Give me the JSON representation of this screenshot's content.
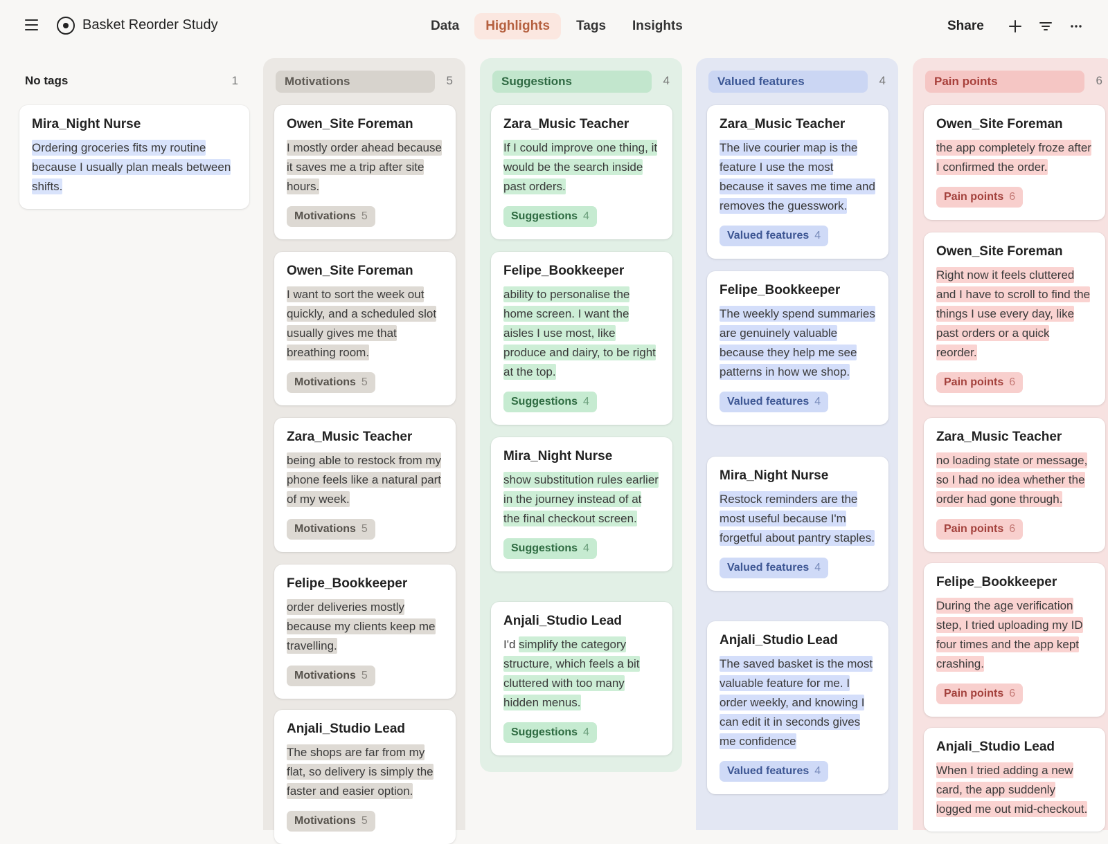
{
  "app": {
    "title": "Basket Reorder Study"
  },
  "tabs": [
    {
      "label": "Data"
    },
    {
      "label": "Highlights",
      "active": true
    },
    {
      "label": "Tags"
    },
    {
      "label": "Insights"
    }
  ],
  "actions": {
    "share_label": "Share"
  },
  "icons": {
    "menu": "hamburger-menu-icon",
    "logo": "record-circle-icon",
    "add": "plus-icon",
    "filter": "filter-icon",
    "more": "more-horizontal-icon"
  },
  "colors": {
    "active_tab_bg": "#fbe7e0",
    "active_tab_text": "#b5603f",
    "motivations": "#d7d3cd",
    "suggestions": "#c2e6cd",
    "valued_features": "#cbd6f3",
    "pain_points": "#f5c6c4"
  },
  "columns": {
    "none": {
      "title": "No tags",
      "count": "1",
      "cards": [
        {
          "author": "Mira_Night Nurse",
          "text": "Ordering groceries fits my routine because I usually plan meals between shifts."
        }
      ]
    },
    "motivations": {
      "title": "Motivations",
      "count": "5",
      "cards": [
        {
          "author": "Owen_Site Foreman",
          "text": "I mostly order ahead because it saves me a trip after site hours.",
          "tag": "Motivations",
          "tag_count": "5"
        },
        {
          "author": "Owen_Site Foreman",
          "text": "I want to sort the week out quickly, and a scheduled slot usually gives me that breathing room.",
          "tag": "Motivations",
          "tag_count": "5"
        },
        {
          "author": "Zara_Music Teacher",
          "text": "being able to restock from my phone feels like a natural part of my week.",
          "tag": "Motivations",
          "tag_count": "5"
        },
        {
          "author": "Felipe_Bookkeeper",
          "text": "order deliveries mostly because my clients keep me travelling.",
          "tag": "Motivations",
          "tag_count": "5"
        },
        {
          "author": "Anjali_Studio Lead",
          "text": "The shops are far from my flat, so delivery is simply the faster and easier option.",
          "tag": "Motivations",
          "tag_count": "5"
        }
      ]
    },
    "suggestions": {
      "title": "Suggestions",
      "count": "4",
      "cards": [
        {
          "author": "Zara_Music Teacher",
          "text": "If I could improve one thing, it would be the search inside past orders.",
          "tag": "Suggestions",
          "tag_count": "4"
        },
        {
          "author": "Felipe_Bookkeeper",
          "text": "ability to personalise the home screen. I want the aisles I use most, like produce and dairy, to be right at the top.",
          "tag": "Suggestions",
          "tag_count": "4"
        },
        {
          "author": "Mira_Night Nurse",
          "text": "show substitution rules earlier in the journey instead of at the final checkout screen.",
          "tag": "Suggestions",
          "tag_count": "4"
        },
        {
          "author": "Anjali_Studio Lead",
          "prefix": "I'd ",
          "text": "simplify the category structure, which feels a bit cluttered with too many hidden menus.",
          "tag": "Suggestions",
          "tag_count": "4"
        }
      ]
    },
    "valued": {
      "title": "Valued features",
      "count": "4",
      "cards": [
        {
          "author": "Zara_Music Teacher",
          "text": "The live courier map is the feature I use the most because it saves me time and removes the guesswork.",
          "tag": "Valued features",
          "tag_count": "4"
        },
        {
          "author": "Felipe_Bookkeeper",
          "text": "The weekly spend summaries are genuinely valuable because they help me see patterns in how we shop.",
          "tag": "Valued features",
          "tag_count": "4"
        },
        {
          "author": "Mira_Night Nurse",
          "text": "Restock reminders are the most useful because I'm forgetful about pantry staples.",
          "tag": "Valued features",
          "tag_count": "4"
        },
        {
          "author": "Anjali_Studio Lead",
          "text": "The saved basket is the most valuable feature for me. I order weekly, and knowing I can edit it in seconds gives me confidence",
          "tag": "Valued features",
          "tag_count": "4"
        }
      ]
    },
    "pain": {
      "title": "Pain points",
      "count": "6",
      "cards": [
        {
          "author": "Owen_Site Foreman",
          "text": "the app completely froze after I confirmed the order.",
          "tag": "Pain points",
          "tag_count": "6"
        },
        {
          "author": "Owen_Site Foreman",
          "text": "Right now it feels cluttered and I have to scroll to find the things I use every day, like past orders or a quick reorder.",
          "tag": "Pain points",
          "tag_count": "6"
        },
        {
          "author": "Zara_Music Teacher",
          "text": "no loading state or message, so I had no idea whether the order had gone through.",
          "tag": "Pain points",
          "tag_count": "6"
        },
        {
          "author": "Felipe_Bookkeeper",
          "text": "During the age verification step, I tried uploading my ID four times and the app kept crashing.",
          "tag": "Pain points",
          "tag_count": "6"
        },
        {
          "author": "Anjali_Studio Lead",
          "text": "When I tried adding a new card, the app suddenly logged me out mid-checkout."
        }
      ]
    }
  }
}
